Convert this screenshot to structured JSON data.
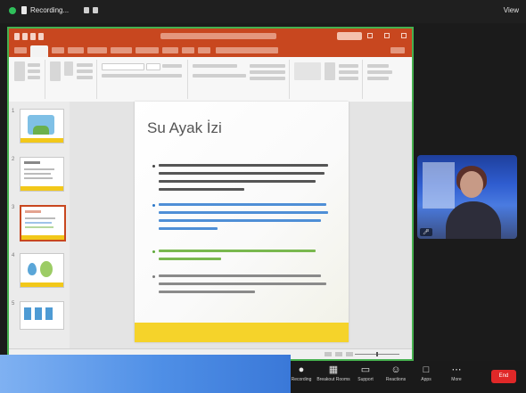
{
  "topbar": {
    "recording_text": "Recording...",
    "view_label": "View"
  },
  "powerpoint": {
    "status_text": ""
  },
  "slide": {
    "title": "Su Ayak İzi",
    "bullet_colors": [
      "#444444",
      "#2a77c9",
      "#5fa83a",
      "#7a7a7a"
    ],
    "accent_color": "#f5d32a"
  },
  "thumbnails": [
    {
      "number": "1"
    },
    {
      "number": "2"
    },
    {
      "number": "3"
    },
    {
      "number": "4"
    },
    {
      "number": "5"
    }
  ],
  "webcam": {
    "participant_name": ""
  },
  "toolbar": {
    "items": [
      {
        "label": "Recording",
        "icon": "record-icon"
      },
      {
        "label": "Breakout Rooms",
        "icon": "breakout-rooms-icon"
      },
      {
        "label": "Support",
        "icon": "support-icon"
      },
      {
        "label": "Reactions",
        "icon": "reactions-icon"
      },
      {
        "label": "Apps",
        "icon": "apps-icon"
      },
      {
        "label": "More",
        "icon": "more-icon"
      }
    ],
    "end_label": "End"
  },
  "colors": {
    "powerpoint_accent": "#c8471f",
    "share_outline": "#46b04f",
    "end_button": "#e02828"
  }
}
